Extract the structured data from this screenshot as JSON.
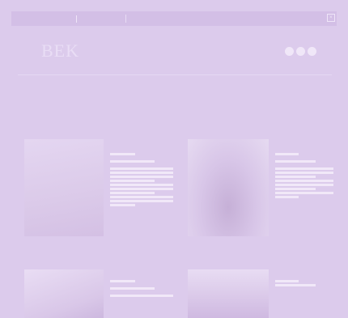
{
  "topnav": {
    "links": [
      "",
      "",
      "",
      "",
      "",
      ""
    ],
    "search_placeholder": "",
    "corner_glyph": "×"
  },
  "brand": {
    "logo": "BEK",
    "subtitle_line1": "",
    "subtitle_line2": ""
  },
  "catnav": {
    "items": [
      "",
      "",
      "",
      "",
      "",
      "",
      ""
    ]
  },
  "sections": [
    {
      "title": "",
      "headline": ""
    },
    {
      "title": "",
      "headline": ""
    },
    {
      "title": "",
      "headline": ""
    },
    {
      "title": "",
      "headline": ""
    }
  ],
  "colors": {
    "overlay": "#dccbec",
    "text": "#f1e9f8",
    "nav_bg": "#d3bfe6"
  }
}
